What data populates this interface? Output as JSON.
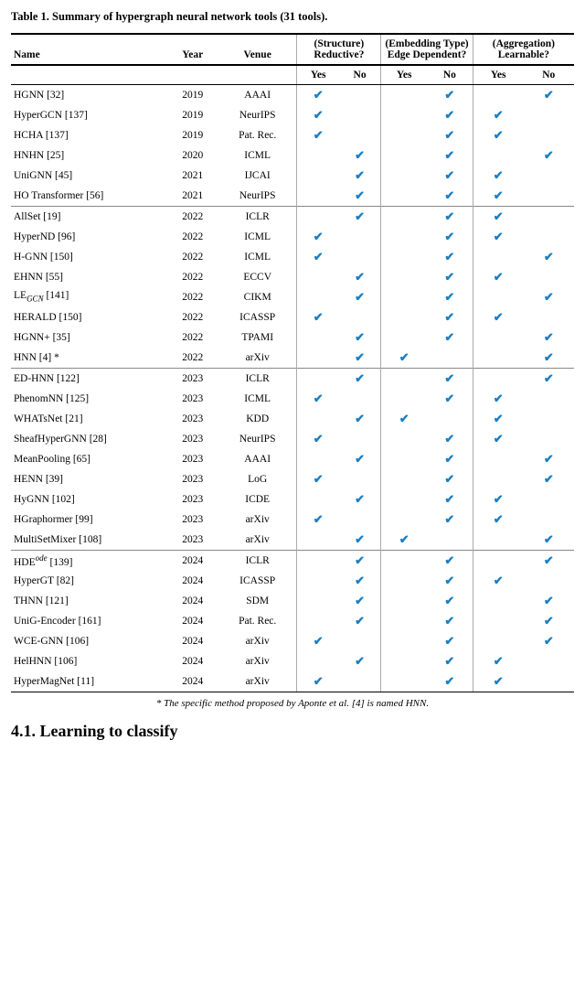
{
  "title": "Table 1. Summary of hypergraph neural network tools (31 tools).",
  "columns": {
    "name": "Name",
    "year": "Year",
    "venue": "Venue",
    "structure_yes": "Yes",
    "structure_no": "No",
    "embedding_yes": "Yes",
    "embedding_no": "No",
    "aggregation_yes": "Yes",
    "aggregation_no": "No",
    "structure_header": "(Structure) Reductive?",
    "embedding_header": "(Embedding Type) Edge Dependent?",
    "aggregation_header": "(Aggregation) Learnable?"
  },
  "rows": [
    {
      "name": "HGNN [32]",
      "year": "2019",
      "venue": "AAAI",
      "sy": "✔",
      "sn": "",
      "ey": "",
      "en": "✔",
      "ay": "",
      "an": "✔",
      "group": 1
    },
    {
      "name": "HyperGCN [137]",
      "year": "2019",
      "venue": "NeurIPS",
      "sy": "✔",
      "sn": "",
      "ey": "",
      "en": "✔",
      "ay": "✔",
      "an": "",
      "group": 1
    },
    {
      "name": "HCHA [137]",
      "year": "2019",
      "venue": "Pat. Rec.",
      "sy": "✔",
      "sn": "",
      "ey": "",
      "en": "✔",
      "ay": "✔",
      "an": "",
      "group": 1
    },
    {
      "name": "HNHN [25]",
      "year": "2020",
      "venue": "ICML",
      "sy": "",
      "sn": "✔",
      "ey": "",
      "en": "✔",
      "ay": "",
      "an": "✔",
      "group": 1
    },
    {
      "name": "UniGNN [45]",
      "year": "2021",
      "venue": "IJCAI",
      "sy": "",
      "sn": "✔",
      "ey": "",
      "en": "✔",
      "ay": "✔",
      "an": "",
      "group": 1
    },
    {
      "name": "HO Transformer [56]",
      "year": "2021",
      "venue": "NeurIPS",
      "sy": "",
      "sn": "✔",
      "ey": "",
      "en": "✔",
      "ay": "✔",
      "an": "",
      "group": 1
    },
    {
      "name": "AllSet [19]",
      "year": "2022",
      "venue": "ICLR",
      "sy": "",
      "sn": "✔",
      "ey": "",
      "en": "✔",
      "ay": "✔",
      "an": "",
      "group": 2
    },
    {
      "name": "HyperND [96]",
      "year": "2022",
      "venue": "ICML",
      "sy": "✔",
      "sn": "",
      "ey": "",
      "en": "✔",
      "ay": "✔",
      "an": "",
      "group": 2
    },
    {
      "name": "H-GNN [150]",
      "year": "2022",
      "venue": "ICML",
      "sy": "✔",
      "sn": "",
      "ey": "",
      "en": "✔",
      "ay": "",
      "an": "✔",
      "group": 2
    },
    {
      "name": "EHNN [55]",
      "year": "2022",
      "venue": "ECCV",
      "sy": "",
      "sn": "✔",
      "ey": "",
      "en": "✔",
      "ay": "✔",
      "an": "",
      "group": 2
    },
    {
      "name": "LE<sub><i>GCN</i></sub> [141]",
      "year": "2022",
      "venue": "CIKM",
      "sy": "",
      "sn": "✔",
      "ey": "",
      "en": "✔",
      "ay": "",
      "an": "✔",
      "group": 2
    },
    {
      "name": "HERALD [150]",
      "year": "2022",
      "venue": "ICASSP",
      "sy": "✔",
      "sn": "",
      "ey": "",
      "en": "✔",
      "ay": "✔",
      "an": "",
      "group": 2
    },
    {
      "name": "HGNN+ [35]",
      "year": "2022",
      "venue": "TPAMI",
      "sy": "",
      "sn": "✔",
      "ey": "",
      "en": "✔",
      "ay": "",
      "an": "✔",
      "group": 2
    },
    {
      "name": "HNN [4] *",
      "year": "2022",
      "venue": "arXiv",
      "sy": "",
      "sn": "✔",
      "ey": "✔",
      "en": "",
      "ay": "",
      "an": "✔",
      "group": 2
    },
    {
      "name": "ED-HNN [122]",
      "year": "2023",
      "venue": "ICLR",
      "sy": "",
      "sn": "✔",
      "ey": "",
      "en": "✔",
      "ay": "",
      "an": "✔",
      "group": 3
    },
    {
      "name": "PhenomNN [125]",
      "year": "2023",
      "venue": "ICML",
      "sy": "✔",
      "sn": "",
      "ey": "",
      "en": "✔",
      "ay": "✔",
      "an": "",
      "group": 3
    },
    {
      "name": "WHATsNet [21]",
      "year": "2023",
      "venue": "KDD",
      "sy": "",
      "sn": "✔",
      "ey": "✔",
      "en": "",
      "ay": "✔",
      "an": "",
      "group": 3
    },
    {
      "name": "SheafHyperGNN [28]",
      "year": "2023",
      "venue": "NeurIPS",
      "sy": "✔",
      "sn": "",
      "ey": "",
      "en": "✔",
      "ay": "✔",
      "an": "",
      "group": 3
    },
    {
      "name": "MeanPooling [65]",
      "year": "2023",
      "venue": "AAAI",
      "sy": "",
      "sn": "✔",
      "ey": "",
      "en": "✔",
      "ay": "",
      "an": "✔",
      "group": 3
    },
    {
      "name": "HENN [39]",
      "year": "2023",
      "venue": "LoG",
      "sy": "✔",
      "sn": "",
      "ey": "",
      "en": "✔",
      "ay": "",
      "an": "✔",
      "group": 3
    },
    {
      "name": "HyGNN [102]",
      "year": "2023",
      "venue": "ICDE",
      "sy": "",
      "sn": "✔",
      "ey": "",
      "en": "✔",
      "ay": "✔",
      "an": "",
      "group": 3
    },
    {
      "name": "HGraphormer [99]",
      "year": "2023",
      "venue": "arXiv",
      "sy": "✔",
      "sn": "",
      "ey": "",
      "en": "✔",
      "ay": "✔",
      "an": "",
      "group": 3
    },
    {
      "name": "MultiSetMixer [108]",
      "year": "2023",
      "venue": "arXiv",
      "sy": "",
      "sn": "✔",
      "ey": "✔",
      "en": "",
      "ay": "",
      "an": "✔",
      "group": 3
    },
    {
      "name": "HDE<sup><i>ode</i></sup> [139]",
      "year": "2024",
      "venue": "ICLR",
      "sy": "",
      "sn": "✔",
      "ey": "",
      "en": "✔",
      "ay": "",
      "an": "✔",
      "group": 4
    },
    {
      "name": "HyperGT [82]",
      "year": "2024",
      "venue": "ICASSP",
      "sy": "",
      "sn": "✔",
      "ey": "",
      "en": "✔",
      "ay": "✔",
      "an": "",
      "group": 4
    },
    {
      "name": "THNN [121]",
      "year": "2024",
      "venue": "SDM",
      "sy": "",
      "sn": "✔",
      "ey": "",
      "en": "✔",
      "ay": "",
      "an": "✔",
      "group": 4
    },
    {
      "name": "UniG-Encoder [161]",
      "year": "2024",
      "venue": "Pat. Rec.",
      "sy": "",
      "sn": "✔",
      "ey": "",
      "en": "✔",
      "ay": "",
      "an": "✔",
      "group": 4
    },
    {
      "name": "WCE-GNN [106]",
      "year": "2024",
      "venue": "arXiv",
      "sy": "✔",
      "sn": "",
      "ey": "",
      "en": "✔",
      "ay": "",
      "an": "✔",
      "group": 4
    },
    {
      "name": "HelHNN [106]",
      "year": "2024",
      "venue": "arXiv",
      "sy": "",
      "sn": "✔",
      "ey": "",
      "en": "✔",
      "ay": "✔",
      "an": "",
      "group": 4
    },
    {
      "name": "HyperMagNet [11]",
      "year": "2024",
      "venue": "arXiv",
      "sy": "✔",
      "sn": "",
      "ey": "",
      "en": "✔",
      "ay": "✔",
      "an": "",
      "group": 4
    }
  ],
  "footnote": "* The specific method proposed by Aponte et al. [4] is named HNN.",
  "section_heading": "4.1.   Learning to classify"
}
